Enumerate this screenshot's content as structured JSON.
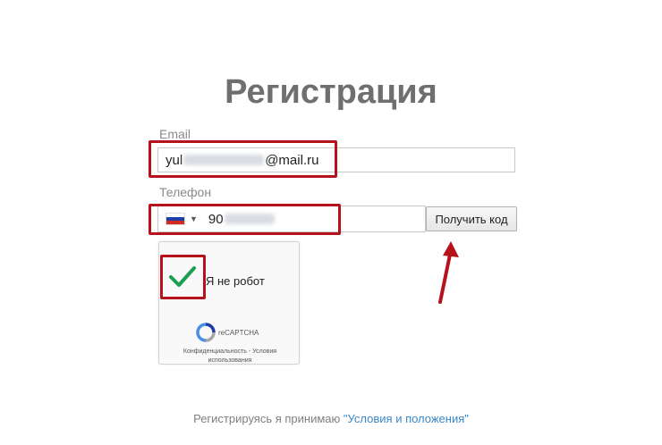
{
  "page": {
    "title": "Регистрация"
  },
  "email": {
    "label": "Email",
    "prefix": "yul",
    "suffix": "@mail.ru"
  },
  "phone": {
    "label": "Телефон",
    "country": "RU",
    "prefix": "90",
    "button_label": "Получить код"
  },
  "recaptcha": {
    "checkbox_label": "Я не робот",
    "brand": "reCAPTCHA",
    "privacy_link": "Конфиденциальность",
    "separator": "-",
    "terms_link": "Условия использования"
  },
  "footer": {
    "text": "Регистрируясь я принимаю",
    "link_text": "\"Условия и положения\""
  },
  "colors": {
    "highlight": "#b5121b",
    "link": "#3a87c8",
    "check": "#1e9e50"
  }
}
